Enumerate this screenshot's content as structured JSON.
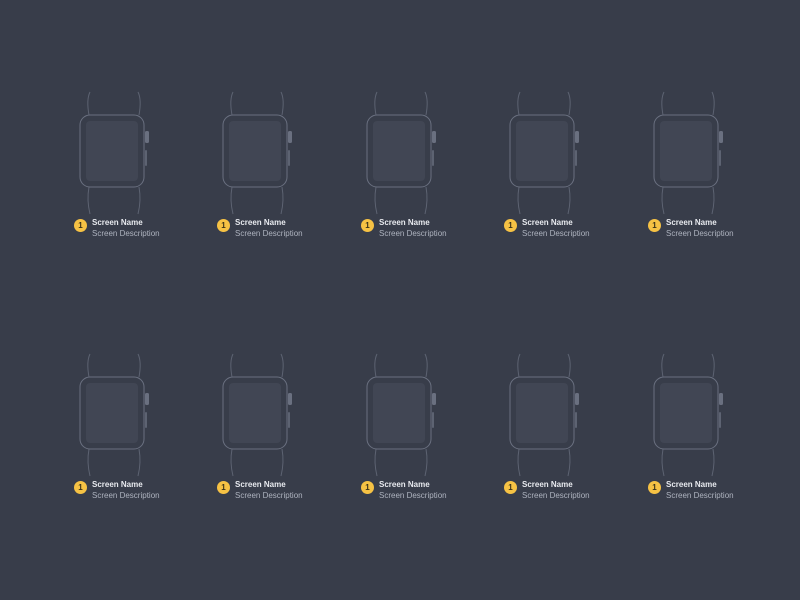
{
  "colors": {
    "background": "#383d4a",
    "outline": "#5d6372",
    "screen": "#414654",
    "badge": "#f6c244"
  },
  "screens": [
    {
      "badge": "1",
      "name": "Screen Name",
      "description": "Screen Description"
    },
    {
      "badge": "1",
      "name": "Screen Name",
      "description": "Screen Description"
    },
    {
      "badge": "1",
      "name": "Screen Name",
      "description": "Screen Description"
    },
    {
      "badge": "1",
      "name": "Screen Name",
      "description": "Screen Description"
    },
    {
      "badge": "1",
      "name": "Screen Name",
      "description": "Screen Description"
    },
    {
      "badge": "1",
      "name": "Screen Name",
      "description": "Screen Description"
    },
    {
      "badge": "1",
      "name": "Screen Name",
      "description": "Screen Description"
    },
    {
      "badge": "1",
      "name": "Screen Name",
      "description": "Screen Description"
    },
    {
      "badge": "1",
      "name": "Screen Name",
      "description": "Screen Description"
    },
    {
      "badge": "1",
      "name": "Screen Name",
      "description": "Screen Description"
    }
  ]
}
